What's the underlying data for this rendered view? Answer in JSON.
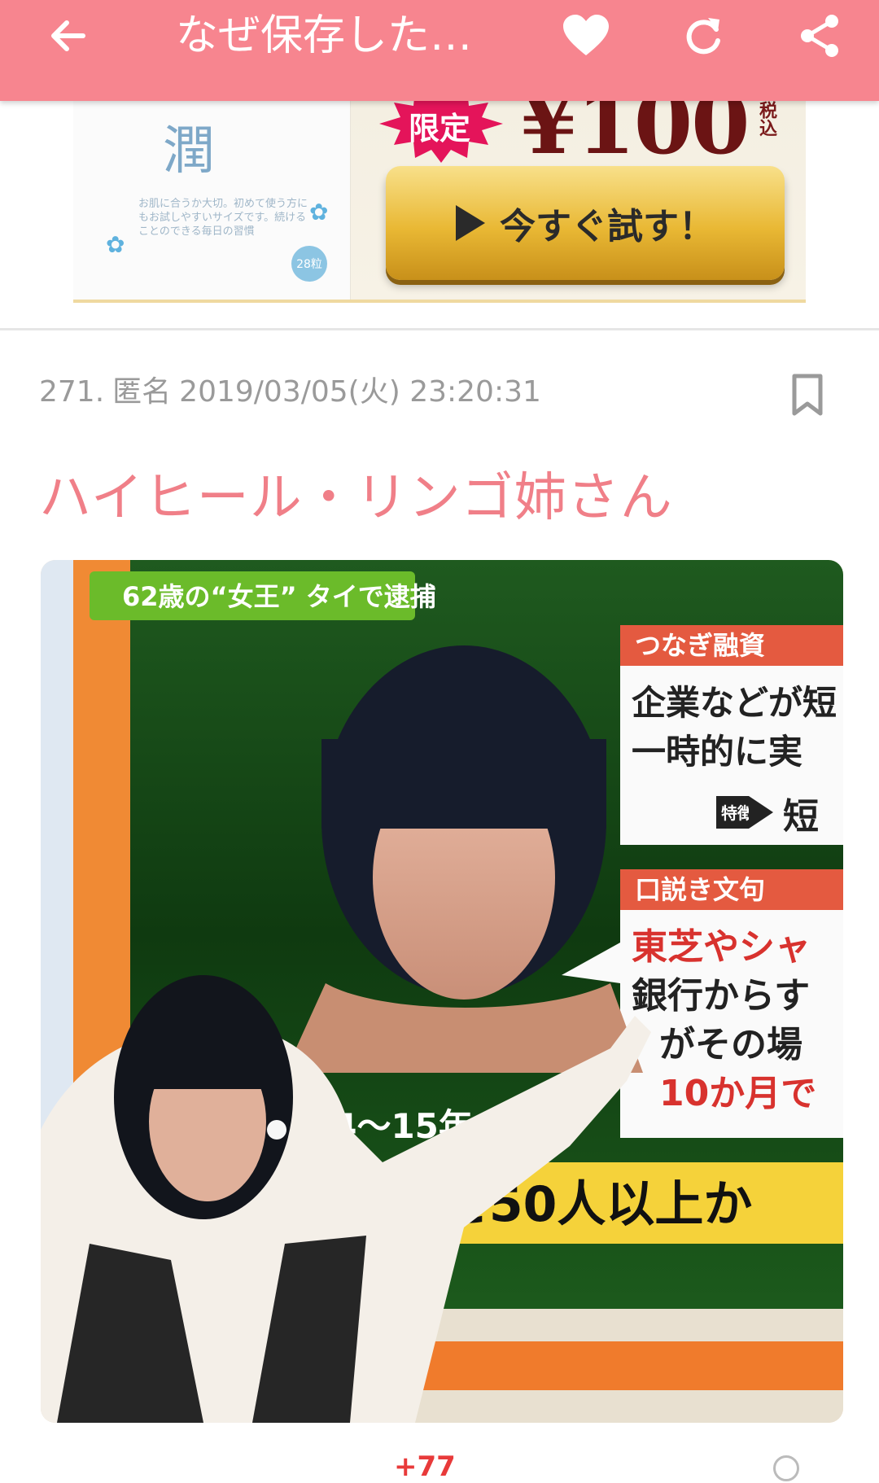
{
  "app_bar": {
    "title": "なぜ保存した…",
    "back_icon": "arrow-left-icon",
    "favorite_icon": "heart-icon",
    "reload_icon": "reload-icon",
    "share_icon": "share-icon",
    "bg_color": "#f7858f"
  },
  "ad": {
    "package_kanji": "潤",
    "package_text": "お肌に合うか大切。初めて使う方にもお試しやすいサイズです。続けることのできる毎日の習慣",
    "package_badge": "28粒",
    "limited_label": "限定",
    "price": "¥100",
    "tax_label": "税込",
    "cta_label": "今すぐ試す！"
  },
  "comment": {
    "number": "271.",
    "author": "匿名",
    "datetime": "2019/03/05(火) 23:20:31",
    "body": "ハイヒール・リンゴ姉さん",
    "body_color": "#f07f88",
    "bookmark_icon": "bookmark-icon",
    "image": {
      "tv_headline": "62歳の“女王” タイで逮捕",
      "label_1": "つなぎ融資",
      "text_1a": "企業などが短",
      "text_1b": "一時的に実",
      "tag_1": "特徴",
      "text_1c": "短",
      "label_2": "口説き文句",
      "text_2a": "東芝やシャ",
      "text_2b": "銀行からす",
      "text_2c": "がその場",
      "text_2d": "10か月で",
      "years": "14〜15年",
      "bottom_strip": "井 と50人以上か"
    }
  },
  "votes": {
    "plus": "+77"
  }
}
